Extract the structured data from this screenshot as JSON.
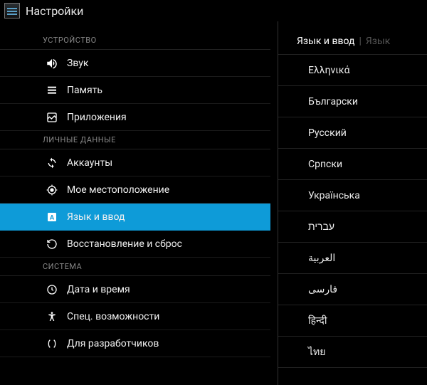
{
  "header": {
    "title": "Настройки"
  },
  "sections": {
    "device": {
      "label": "УСТРОЙСТВО",
      "items": {
        "sound": "Звук",
        "memory": "Память",
        "apps": "Приложения"
      }
    },
    "personal": {
      "label": "ЛИЧНЫЕ ДАННЫЕ",
      "items": {
        "accounts": "Аккаунты",
        "location": "Мое местоположение",
        "language": "Язык и ввод",
        "backup": "Восстановление и сброс"
      }
    },
    "system": {
      "label": "СИСТЕМА",
      "items": {
        "datetime": "Дата и время",
        "accessibility": "Спец. возможности",
        "developer": "Для разработчиков"
      }
    }
  },
  "right_panel": {
    "breadcrumb_active": "Язык и ввод",
    "breadcrumb_dim": "Язык",
    "languages": [
      "Ελληνικά",
      "Български",
      "Русский",
      "Српски",
      "Українська",
      "עברית",
      "العربية",
      "فارسی",
      "हिन्दी",
      "ไทย"
    ]
  }
}
